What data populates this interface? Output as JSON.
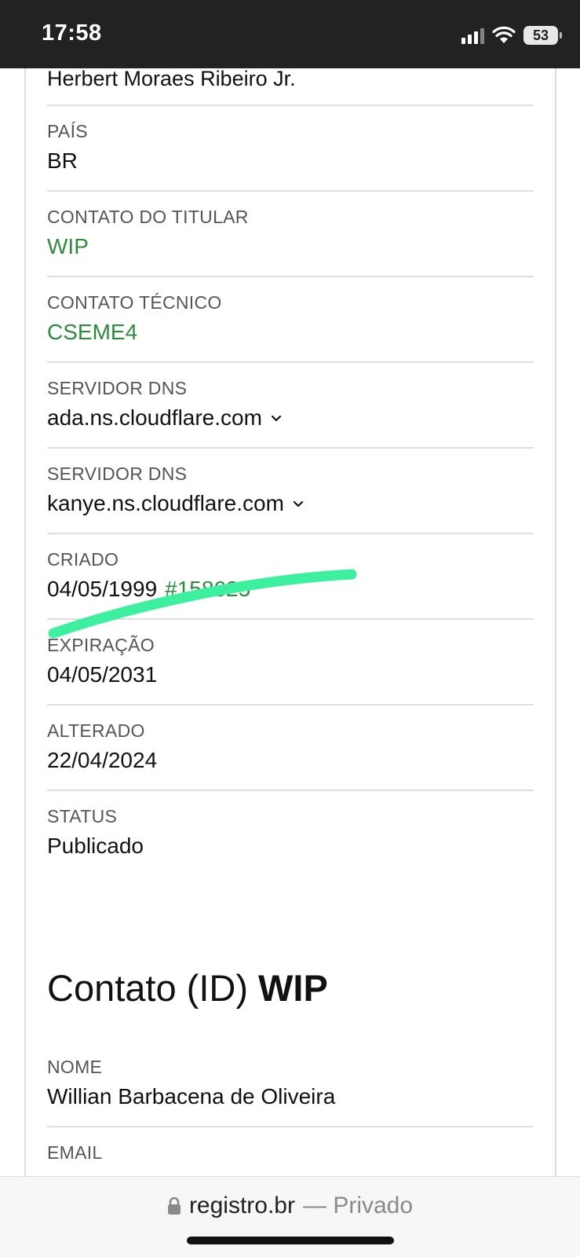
{
  "status_bar": {
    "time": "17:58",
    "battery": "53"
  },
  "domain_info": {
    "owner_name": "Herbert Moraes Ribeiro Jr.",
    "fields": [
      {
        "label": "PAÍS",
        "value": "BR",
        "link": false
      },
      {
        "label": "CONTATO DO TITULAR",
        "value": "WIP",
        "link": true
      },
      {
        "label": "CONTATO TÉCNICO",
        "value": "CSEME4",
        "link": true
      },
      {
        "label": "SERVIDOR DNS",
        "value": "ada.ns.cloudflare.com",
        "link": false
      },
      {
        "label": "SERVIDOR DNS",
        "value": "kanye.ns.cloudflare.com",
        "link": false
      },
      {
        "label": "CRIADO",
        "value": "04/05/1999",
        "extra": "#158625",
        "link": false
      },
      {
        "label": "EXPIRAÇÃO",
        "value": "04/05/2031",
        "link": false
      },
      {
        "label": "ALTERADO",
        "value": "22/04/2024",
        "link": false
      },
      {
        "label": "STATUS",
        "value": "Publicado",
        "link": false
      }
    ]
  },
  "contact_section": {
    "title_prefix": "Contato (ID) ",
    "title_id": "WIP",
    "fields": [
      {
        "label": "NOME",
        "value": "Willian Barbacena de Oliveira"
      },
      {
        "label": "EMAIL",
        "value": ""
      }
    ]
  },
  "url_bar": {
    "domain": "registro.br",
    "suffix": "— Privado"
  },
  "colors": {
    "link_green": "#2e8b3e",
    "highlight": "#3df0a0",
    "status_bar_bg": "#222222"
  }
}
